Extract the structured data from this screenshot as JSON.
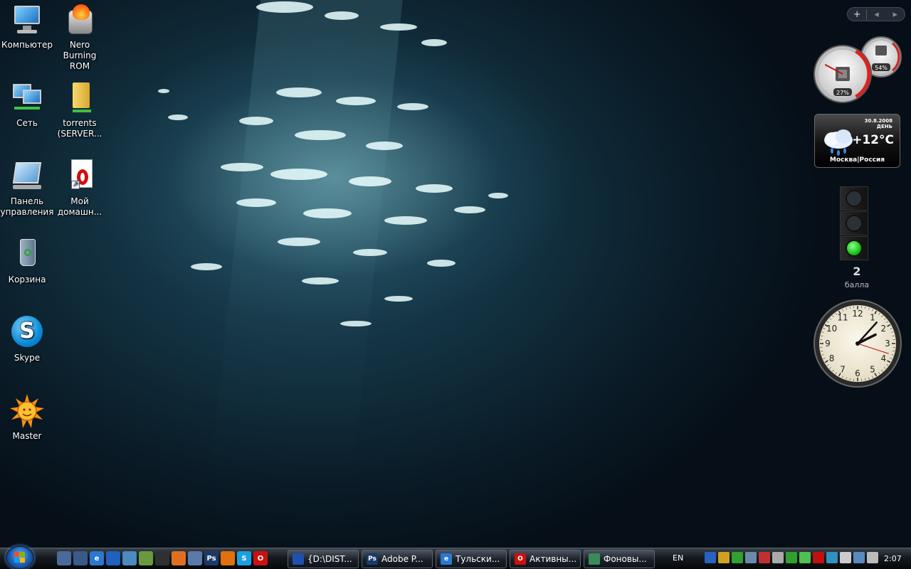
{
  "desktop_icons": [
    {
      "id": "computer",
      "label": "Компьютер",
      "icon": "computer-icon"
    },
    {
      "id": "nero",
      "label": "Nero Burning ROM",
      "icon": "nero-icon"
    },
    {
      "id": "network",
      "label": "Сеть",
      "icon": "network-icon"
    },
    {
      "id": "torrents",
      "label": "torrents (SERVER...",
      "icon": "folder-icon"
    },
    {
      "id": "control-panel",
      "label": "Панель управления",
      "icon": "control-panel-icon"
    },
    {
      "id": "opera-home",
      "label": "Мой домашн...",
      "icon": "opera-shortcut-icon"
    },
    {
      "id": "recycle-bin",
      "label": "Корзина",
      "icon": "recycle-bin-icon"
    },
    {
      "id": "skype",
      "label": "Skype",
      "icon": "skype-icon"
    },
    {
      "id": "master",
      "label": "Master",
      "icon": "sun-icon"
    }
  ],
  "sidebar": {
    "add_label": "+",
    "prev_label": "◂",
    "next_label": "▸",
    "cpu_meter": {
      "cpu_percent": "27%",
      "memory_percent": "54%",
      "cpu_value": 27,
      "memory_value": 54
    },
    "weather": {
      "date": "30.8.2008",
      "period": "ДЕНЬ",
      "temperature": "+12°C",
      "city": "Москва|Россия"
    },
    "traffic": {
      "score": "2",
      "score_label": "балла",
      "active_lamp": 2
    },
    "clock": {
      "hour": 2,
      "minute": 7,
      "second": 18,
      "numbers": [
        "12",
        "1",
        "2",
        "3",
        "4",
        "5",
        "6",
        "7",
        "8",
        "9",
        "10",
        "11"
      ]
    }
  },
  "taskbar": {
    "quick_launch": [
      {
        "icon": "show-desktop-icon",
        "color": "#4a6a9a",
        "text": ""
      },
      {
        "icon": "switch-windows-icon",
        "color": "#3a5a8a",
        "text": ""
      },
      {
        "icon": "internet-explorer-icon",
        "color": "#2a78d0",
        "text": "e"
      },
      {
        "icon": "windows-explorer-icon",
        "color": "#2060c0",
        "text": ""
      },
      {
        "icon": "network-tool-icon",
        "color": "#4a8ac0",
        "text": ""
      },
      {
        "icon": "utility-icon",
        "color": "#6a9a40",
        "text": ""
      },
      {
        "icon": "media-icon",
        "color": "#303030",
        "text": ""
      },
      {
        "icon": "office-icon",
        "color": "#e07020",
        "text": ""
      },
      {
        "icon": "tool-icon",
        "color": "#5a7aaa",
        "text": ""
      },
      {
        "icon": "photoshop-icon",
        "color": "#1a3a6a",
        "text": "Ps"
      },
      {
        "icon": "firefox-icon",
        "color": "#e07010",
        "text": ""
      },
      {
        "icon": "skype-icon",
        "color": "#1aa0e0",
        "text": "S"
      },
      {
        "icon": "opera-icon",
        "color": "#cc1010",
        "text": "O"
      }
    ],
    "tasks": [
      {
        "label": "{D:\\DIST...",
        "icon": "far-manager-icon",
        "color": "#2050b0",
        "text": ""
      },
      {
        "label": "Adobe P...",
        "icon": "photoshop-icon",
        "color": "#1a3a6a",
        "text": "Ps"
      },
      {
        "label": "Тульски...",
        "icon": "internet-explorer-icon",
        "color": "#2a78d0",
        "text": "e"
      },
      {
        "label": "Активны...",
        "icon": "opera-icon",
        "color": "#cc1010",
        "text": "O"
      },
      {
        "label": "Фоновы...",
        "icon": "display-icon",
        "color": "#3a8a5a",
        "text": ""
      }
    ],
    "language": "EN",
    "tray_icons": [
      {
        "icon": "bluetooth-icon",
        "color": "#2a60c0"
      },
      {
        "icon": "antivirus-icon",
        "color": "#d0a020"
      },
      {
        "icon": "security-icon",
        "color": "#30a030"
      },
      {
        "icon": "network-status-icon",
        "color": "#6a8aaa"
      },
      {
        "icon": "alert-icon",
        "color": "#c03030"
      },
      {
        "icon": "usb-icon",
        "color": "#aaaaaa"
      },
      {
        "icon": "update-icon",
        "color": "#30a030"
      },
      {
        "icon": "messenger-icon",
        "color": "#50c050"
      },
      {
        "icon": "ati-icon",
        "color": "#c01010"
      },
      {
        "icon": "help-icon",
        "color": "#3090c0"
      }
    ],
    "tray_icons_right": [
      {
        "icon": "device-icon",
        "color": "#cccccc"
      },
      {
        "icon": "network-connection-icon",
        "color": "#5a8ac0"
      },
      {
        "icon": "volume-icon",
        "color": "#bbbbbb"
      }
    ],
    "time": "2:07"
  }
}
